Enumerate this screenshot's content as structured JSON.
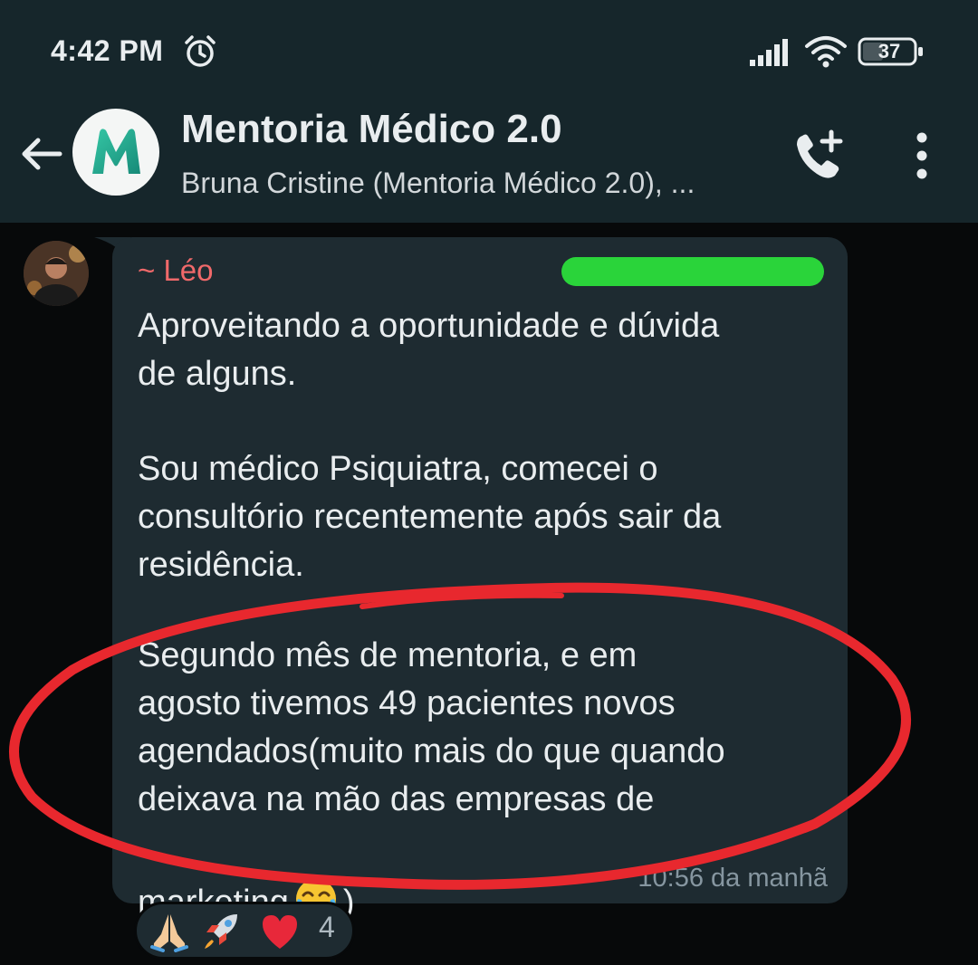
{
  "status_bar": {
    "time": "4:42 PM",
    "battery": "37",
    "icons": [
      "alarm-icon",
      "signal-icon",
      "wifi-icon",
      "battery-icon"
    ]
  },
  "header": {
    "title": "Mentoria Médico 2.0",
    "subtitle": "Bruna Cristine (Mentoria Médico 2.0), ...",
    "avatar_letter": "M",
    "icons": [
      "back-arrow-icon",
      "add-call-icon",
      "more-vertical-icon"
    ]
  },
  "message": {
    "sender": "~ Léo",
    "paragraphs": [
      "Aproveitando a oportunidade e dúvida\nde alguns.",
      "Sou médico Psiquiatra, comecei o\nconsultório recentemente após sair da\nresidência.",
      "Segundo mês de mentoria, e em\nagosto tivemos 49 pacientes novos\nagendados(muito mais do que quando\ndeixava na mão das empresas de",
      "marketing"
    ],
    "closing": ")",
    "timestamp": "10:56 da manhã"
  },
  "reactions": {
    "emojis": [
      "folded-hands-icon",
      "rocket-icon",
      "red-heart-icon",
      "tears-of-joy-icon"
    ],
    "count": "4"
  },
  "colors": {
    "header_bg": "#16262b",
    "chat_bg": "#07090a",
    "bubble_bg": "#1e2b31",
    "sender_name": "#f0696a",
    "annotation_circle": "#e8282e",
    "redaction": "#2ad43a"
  }
}
